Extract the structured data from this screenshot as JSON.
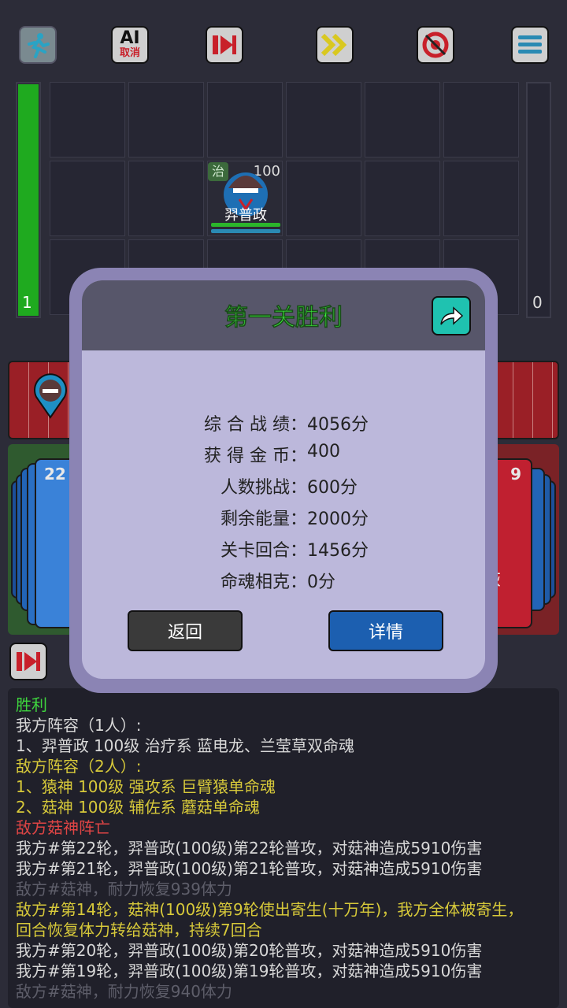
{
  "toolbar": {
    "ai_label": "AI",
    "ai_sub": "取消"
  },
  "battle": {
    "left_energy": "1",
    "right_energy": "0",
    "unit": {
      "badge": "治",
      "level": "100",
      "name": "羿普政"
    }
  },
  "decks": {
    "left_count": "22",
    "right_count": "9",
    "right_partial": "恢"
  },
  "modal": {
    "title": "第一关胜利",
    "stats": [
      {
        "label": "综 合 战 绩：",
        "value": "4056分"
      },
      {
        "label": "获 得 金 币：",
        "value": "400"
      },
      {
        "label": "人数挑战：",
        "value": "600分"
      },
      {
        "label": "剩余能量：",
        "value": "2000分"
      },
      {
        "label": "关卡回合：",
        "value": "1456分"
      },
      {
        "label": "命魂相克：",
        "value": "0分"
      }
    ],
    "back_label": "返回",
    "detail_label": "详情",
    "back_color": "#3a3a3a",
    "detail_color": "#1c5fb0"
  },
  "log": [
    {
      "text": "胜利",
      "color": "green"
    },
    {
      "text": "我方阵容（1人）:",
      "color": "grey"
    },
    {
      "text": "1、羿普政 100级 治疗系 蓝电龙、兰莹草双命魂",
      "color": "grey"
    },
    {
      "text": "敌方阵容（2人）:",
      "color": "yellow"
    },
    {
      "text": "1、猿神 100级 强攻系 巨臂猿单命魂",
      "color": "yellow"
    },
    {
      "text": "2、菇神 100级 辅佐系 蘑菇单命魂",
      "color": "yellow"
    },
    {
      "text": "敌方菇神阵亡",
      "color": "red"
    },
    {
      "text": "我方#第22轮，羿普政(100级)第22轮普攻，对菇神造成5910伤害",
      "color": "grey"
    },
    {
      "text": "我方#第21轮，羿普政(100级)第21轮普攻，对菇神造成5910伤害",
      "color": "grey"
    },
    {
      "text": "敌方#菇神，耐力恢复939体力",
      "color": "dim"
    },
    {
      "text": "敌方#第14轮，菇神(100级)第9轮使出寄生(十万年)，我方全体被寄生，",
      "color": "yellow"
    },
    {
      "text": "回合恢复体力转给菇神，持续7回合",
      "color": "yellow"
    },
    {
      "text": "我方#第20轮，羿普政(100级)第20轮普攻，对菇神造成5910伤害",
      "color": "grey"
    },
    {
      "text": "我方#第19轮，羿普政(100级)第19轮普攻，对菇神造成5910伤害",
      "color": "grey"
    },
    {
      "text": "敌方#菇神，耐力恢复940体力",
      "color": "dim"
    }
  ]
}
